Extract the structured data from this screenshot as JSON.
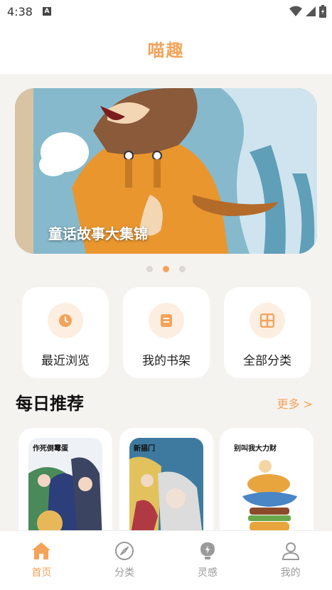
{
  "status": {
    "time": "4:38",
    "notification_glyph": "A"
  },
  "header": {
    "title": "喵趣"
  },
  "banner": {
    "caption": "童话故事大集锦",
    "active_index": 1,
    "dot_count": 3
  },
  "quick_actions": [
    {
      "label": "最近浏览",
      "icon": "clock-icon"
    },
    {
      "label": "我的书架",
      "icon": "book-icon"
    },
    {
      "label": "全部分类",
      "icon": "grid-icon"
    }
  ],
  "recommend": {
    "title": "每日推荐",
    "more": "更多 >",
    "items": [
      {
        "cover_text": "作死倒霉蛋"
      },
      {
        "cover_text": "新猖门"
      },
      {
        "cover_text": "别叫我大力财"
      }
    ]
  },
  "tabbar": {
    "items": [
      {
        "label": "首页",
        "icon": "home-icon",
        "active": true
      },
      {
        "label": "分类",
        "icon": "compass-icon",
        "active": false
      },
      {
        "label": "灵感",
        "icon": "lightbulb-icon",
        "active": false
      },
      {
        "label": "我的",
        "icon": "user-icon",
        "active": false
      }
    ]
  },
  "colors": {
    "accent": "#f4a35a",
    "background": "#f5f3f0"
  }
}
